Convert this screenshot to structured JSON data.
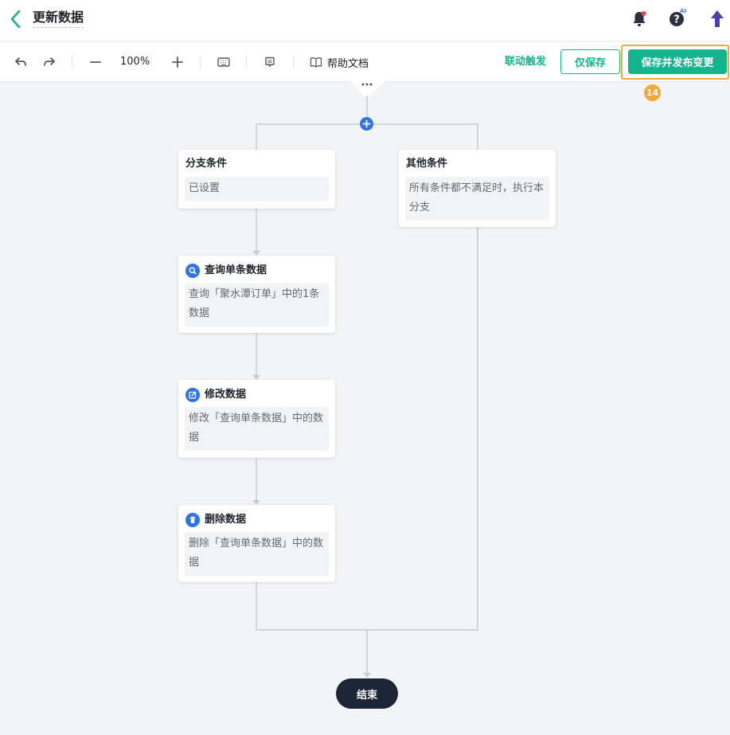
{
  "header": {
    "title": "更新数据",
    "icons": [
      "back-arrow-icon",
      "bell-icon",
      "help-icon",
      "upload-icon"
    ],
    "ai_badge": "AI",
    "notification_color": "#e54545"
  },
  "toolbar": {
    "zoom": "100%",
    "help_label": "帮助文档",
    "link_trigger_label": "联动触发",
    "save_label": "仅保存",
    "publish_label": "保存并发布变更",
    "step_number": "14",
    "icons": [
      "undo-icon",
      "redo-icon",
      "zoom-out-icon",
      "zoom-in-icon",
      "keyboard-icon",
      "comment-icon",
      "book-icon"
    ]
  },
  "flow": {
    "branch_condition": {
      "title": "分支条件",
      "body": "已设置"
    },
    "other_condition": {
      "title": "其他条件",
      "body": "所有条件都不满足时，执行本分支"
    },
    "query_node": {
      "title": "查询单条数据",
      "body": "查询「聚水潭订单」中的1条数据",
      "icon": "search-icon"
    },
    "update_node": {
      "title": "修改数据",
      "body": "修改「查询单条数据」中的数据",
      "icon": "edit-icon"
    },
    "delete_node": {
      "title": "删除数据",
      "body": "删除「查询单条数据」中的数据",
      "icon": "trash-icon"
    },
    "end_label": "结束"
  },
  "colors": {
    "accent": "#14b48c",
    "node_icon": "#2f73e8",
    "highlight": "#f0a93a",
    "end_node": "#1c2536"
  }
}
